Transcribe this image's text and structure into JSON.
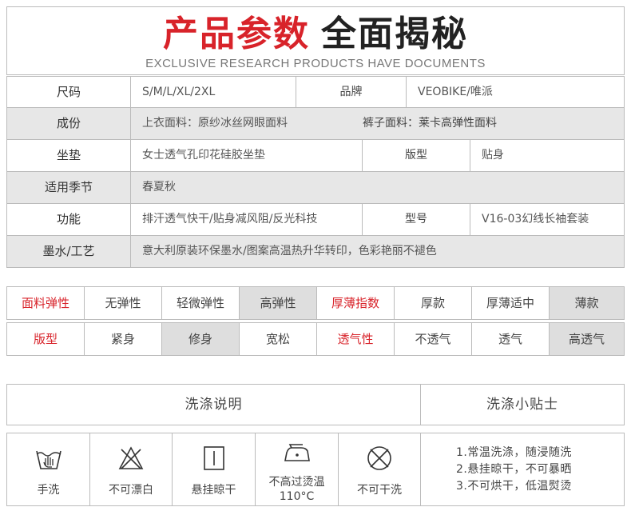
{
  "header": {
    "title_red": "产品参数",
    "title_black": "全面揭秘",
    "subtitle": "EXCLUSIVE RESEARCH PRODUCTS HAVE DOCUMENTS"
  },
  "spec": {
    "size_label": "尺码",
    "size_value": "S/M/L/XL/2XL",
    "brand_label": "品牌",
    "brand_value": "VEOBIKE/唯派",
    "material_label": "成份",
    "material_top": "上衣面料：原纱冰丝网眼面料",
    "material_pants": "裤子面料：莱卡高弹性面料",
    "pad_label": "坐垫",
    "pad_value": "女士透气孔印花硅胶坐垫",
    "fit_label": "版型",
    "fit_value": "贴身",
    "season_label": "适用季节",
    "season_value": "春夏秋",
    "function_label": "功能",
    "function_value": "排汗透气快干/贴身减风阻/反光科技",
    "model_label": "型号",
    "model_value": "V16-03幻线长袖套装",
    "ink_label": "墨水/工艺",
    "ink_value": "意大利原装环保墨水/图案高温热升华转印，色彩艳丽不褪色"
  },
  "properties": {
    "elasticity_label": "面料弹性",
    "elasticity_options": [
      "无弹性",
      "轻微弹性",
      "高弹性"
    ],
    "elasticity_selected": "高弹性",
    "thickness_label": "厚薄指数",
    "thickness_options": [
      "厚款",
      "厚薄适中",
      "薄款"
    ],
    "thickness_selected": "薄款",
    "fit_label": "版型",
    "fit_options": [
      "紧身",
      "修身",
      "宽松"
    ],
    "fit_selected": "修身",
    "breath_label": "透气性",
    "breath_options": [
      "不透气",
      "透气",
      "高透气"
    ],
    "breath_selected": "高透气",
    "highlight_color": "#d8232a",
    "selected_bg": "#dedede"
  },
  "washing": {
    "heading": "洗涤说明",
    "tips_heading": "洗涤小贴士",
    "icons": [
      {
        "icon": "hand-wash-icon",
        "label": "手洗"
      },
      {
        "icon": "no-bleach-icon",
        "label": "不可漂白"
      },
      {
        "icon": "hang-dry-icon",
        "label": "悬挂晾干"
      },
      {
        "icon": "iron-icon",
        "label": "不高过烫温",
        "label2": "110°C"
      },
      {
        "icon": "no-dry-clean-icon",
        "label": "不可干洗"
      }
    ],
    "tips": [
      "1.常温洗涤，随浸随洗",
      "2.悬挂晾干，不可暴晒",
      "3.不可烘干，低温熨烫"
    ]
  }
}
